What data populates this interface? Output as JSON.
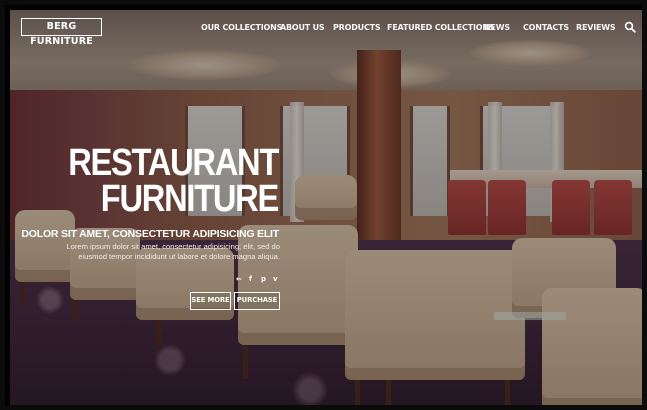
{
  "brand": {
    "logo_text": "BERG FURNITURE"
  },
  "nav": {
    "items": [
      {
        "label": "OUR COLLECTIONS"
      },
      {
        "label": "ABOUT US"
      },
      {
        "label": "PRODUCTS"
      },
      {
        "label": "FEATURED COLLECTIONS"
      },
      {
        "label": "NEWS"
      },
      {
        "label": "CONTACTS"
      },
      {
        "label": "REVIEWS"
      }
    ],
    "search_icon": "search-icon"
  },
  "hero": {
    "title_line1": "RESTAURANT",
    "title_line2": "FURNITURE",
    "subtitle": "DOLOR SIT AMET, CONSECTETUR ADIPISICING ELIT",
    "body": "Lorem ipsum dolor sit amet, consectetur adipisicing; elit, sed do eiusmod tempor incididunt ut labore et dolore magna aliqua.",
    "social": [
      {
        "icon": "share-icon",
        "glyph": "⇜"
      },
      {
        "icon": "facebook-icon",
        "glyph": "f"
      },
      {
        "icon": "pinterest-icon",
        "glyph": "p"
      },
      {
        "icon": "vimeo-icon",
        "glyph": "v"
      }
    ],
    "buttons": {
      "see_more": "SEE MORE",
      "purchase": "PURCHASE"
    }
  },
  "colors": {
    "text": "#ffffff",
    "overlay": "#120c0c",
    "accent_floor": "#3b2238"
  }
}
